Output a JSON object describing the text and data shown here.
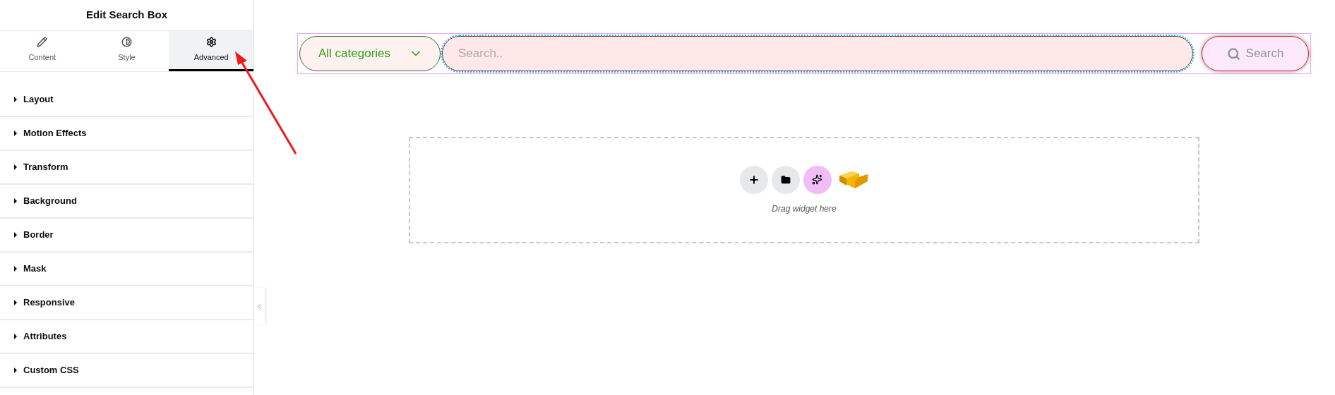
{
  "panel": {
    "title": "Edit Search Box",
    "tabs": [
      {
        "label": "Content",
        "kind": "pencil",
        "selected": false
      },
      {
        "label": "Style",
        "kind": "contrast",
        "selected": false
      },
      {
        "label": "Advanced",
        "kind": "gear",
        "selected": true
      }
    ],
    "sections": [
      {
        "label": "Layout",
        "expanded": false
      },
      {
        "label": "Motion Effects",
        "expanded": false
      },
      {
        "label": "Transform",
        "expanded": false
      },
      {
        "label": "Background",
        "expanded": false
      },
      {
        "label": "Border",
        "expanded": false
      },
      {
        "label": "Mask",
        "expanded": false
      },
      {
        "label": "Responsive",
        "expanded": false
      },
      {
        "label": "Attributes",
        "expanded": false
      },
      {
        "label": "Custom CSS",
        "expanded": false
      }
    ]
  },
  "search_widget": {
    "category": "All categories",
    "placeholder": "Search..",
    "button": "Search"
  },
  "drop_zone": {
    "hint": "Drag widget here"
  }
}
